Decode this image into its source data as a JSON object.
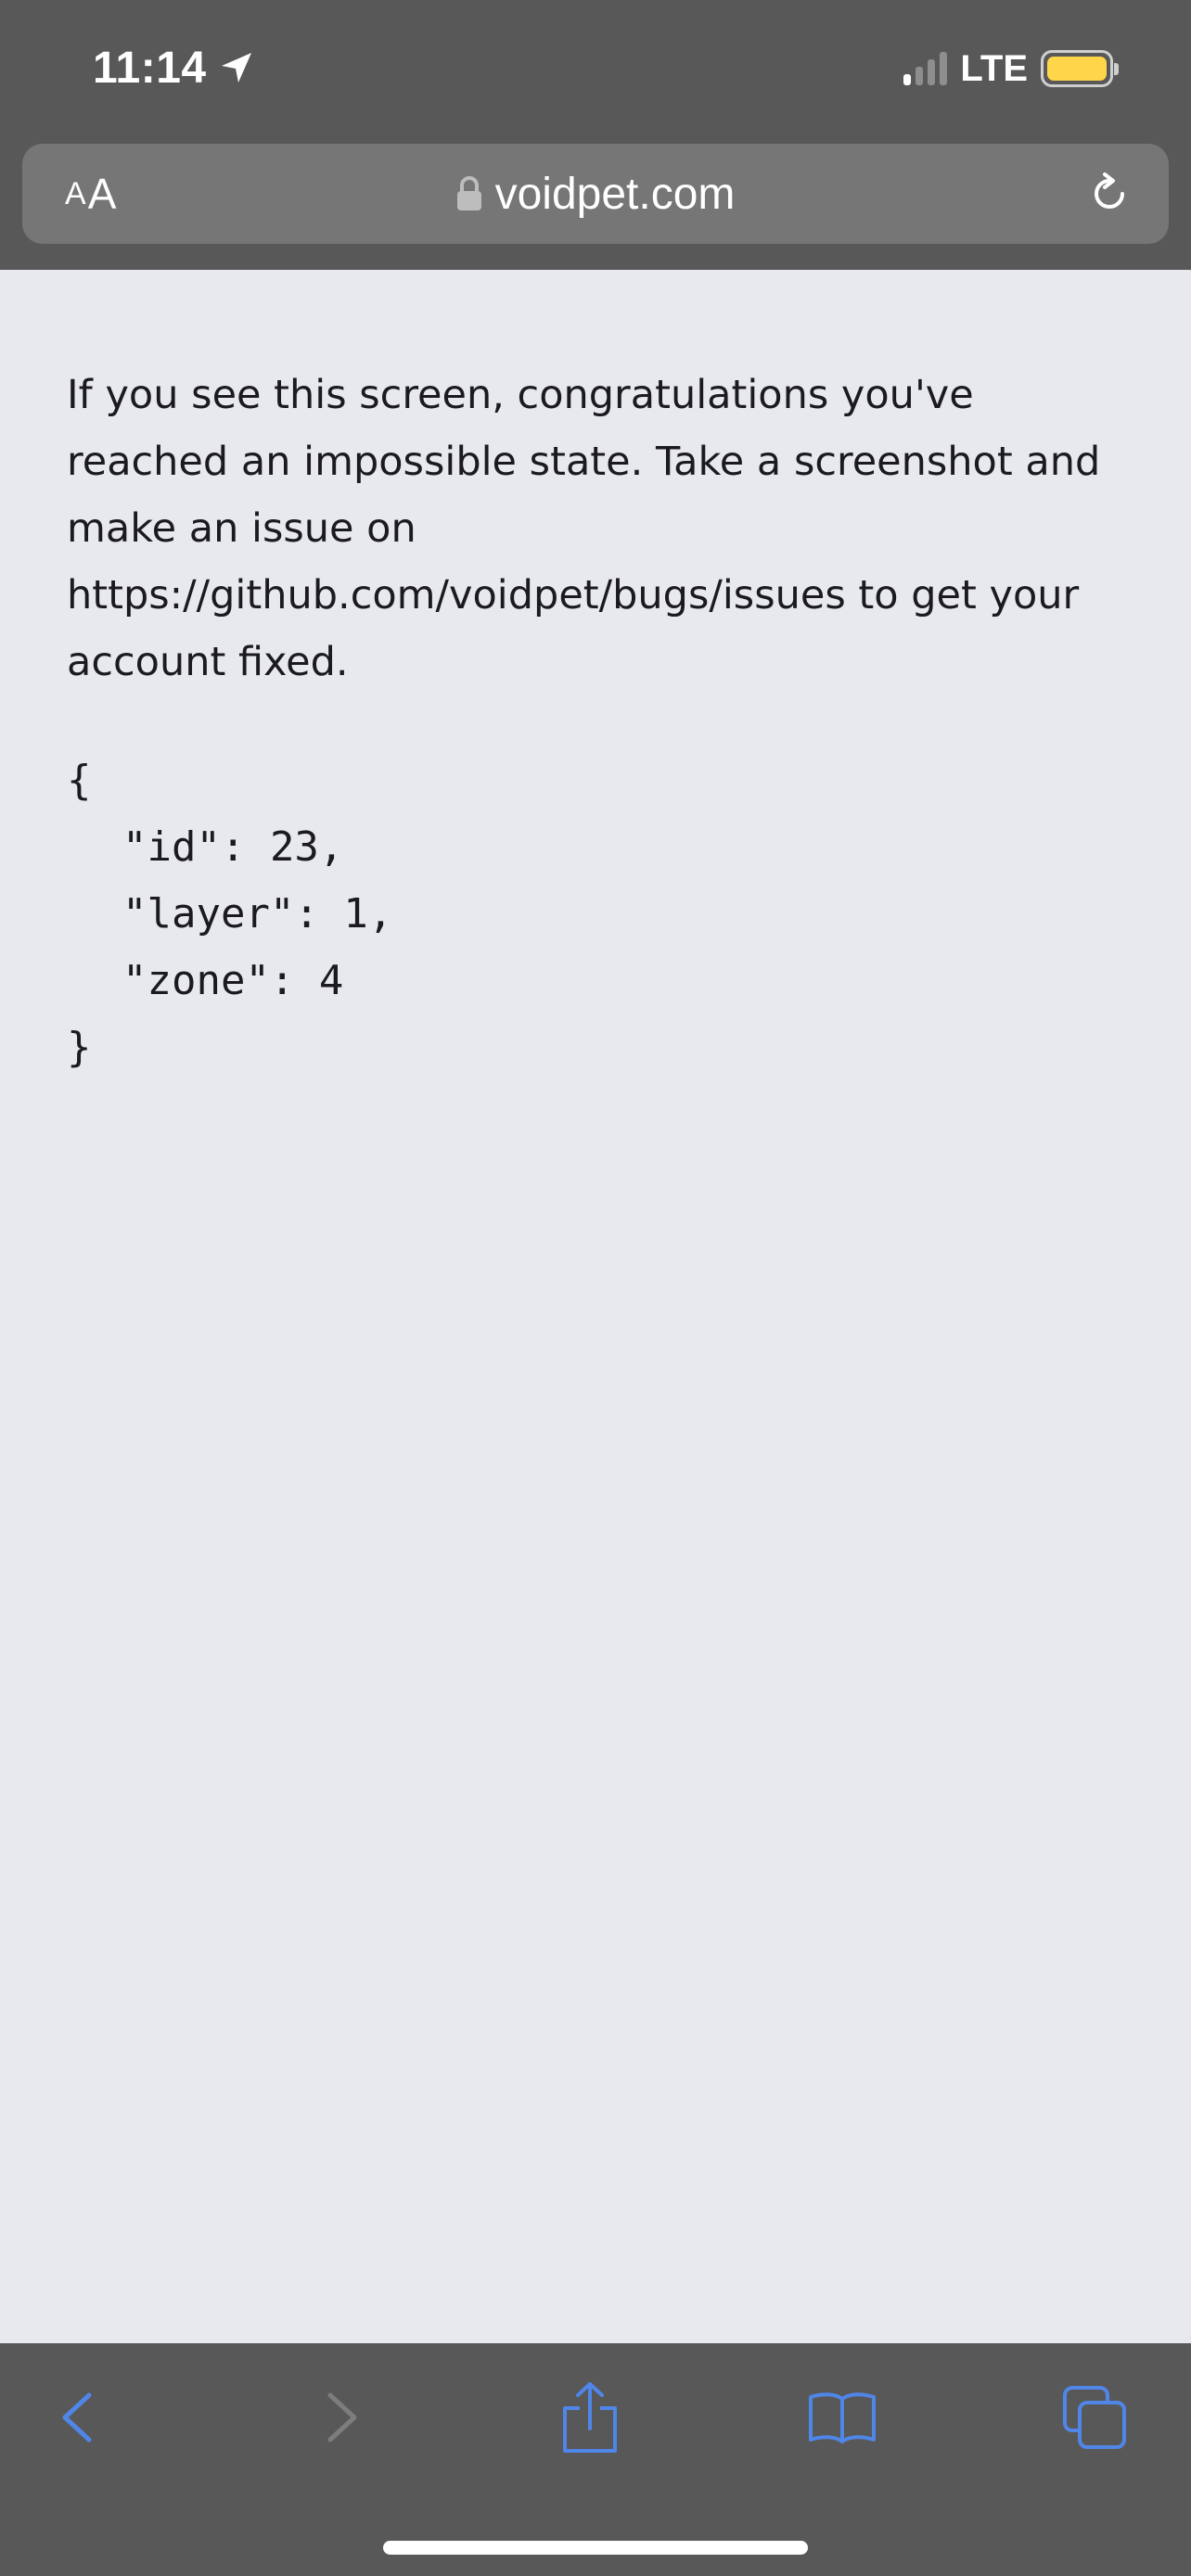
{
  "status_bar": {
    "time": "11:14",
    "network": "LTE",
    "icons": [
      "location-arrow-icon",
      "signal-icon",
      "battery-icon"
    ],
    "battery_color": "#ffd54a"
  },
  "browser": {
    "text_size_label_small": "A",
    "text_size_label_large": "A",
    "url": "voidpet.com",
    "icons": [
      "lock-icon",
      "reload-icon"
    ]
  },
  "page": {
    "message": "If you see this screen, congratulations you've reached an impossible state. Take a screenshot and make an issue on https://github.com/voidpet/bugs/issues to get your account fixed.",
    "json_open": "{",
    "json_lines": [
      "\"id\": 23,",
      "\"layer\": 1,",
      "\"zone\": 4"
    ],
    "json_close": "}"
  },
  "toolbar": {
    "icons": [
      "back-icon",
      "forward-icon",
      "share-icon",
      "bookmarks-icon",
      "tabs-icon"
    ],
    "accent_color": "#4f86e8",
    "disabled_color": "#7d7d7d"
  },
  "colors": {
    "chrome_bg": "#585858",
    "url_bar_bg": "#767676",
    "page_bg": "#e8e9ee",
    "text": "#1b1b1f"
  }
}
